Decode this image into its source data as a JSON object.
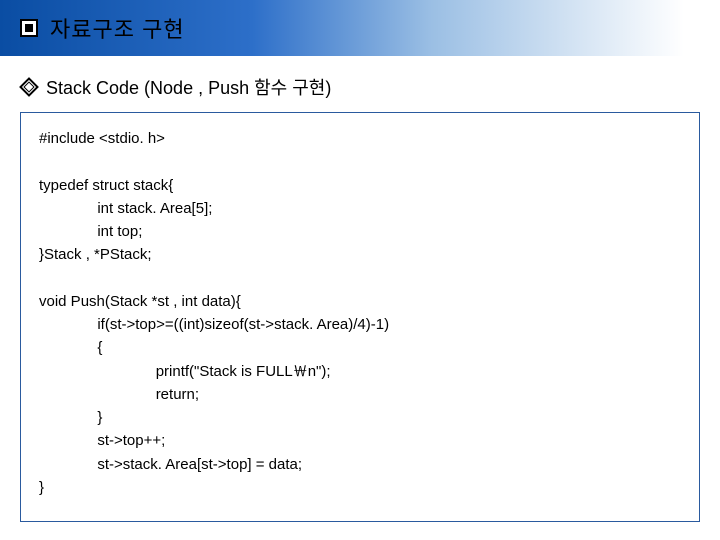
{
  "title": "자료구조 구현",
  "subtitle": "Stack Code (Node , Push 함수 구현)",
  "code": "#include <stdio. h>\n\ntypedef struct stack{\n              int stack. Area[5];\n              int top;\n}Stack , *PStack;\n\nvoid Push(Stack *st , int data){\n              if(st->top>=((int)sizeof(st->stack. Area)/4)-1)\n              {\n                            printf(\"Stack is FULL￦n\");\n                            return;\n              }\n              st->top++;\n              st->stack. Area[st->top] = data;\n}"
}
